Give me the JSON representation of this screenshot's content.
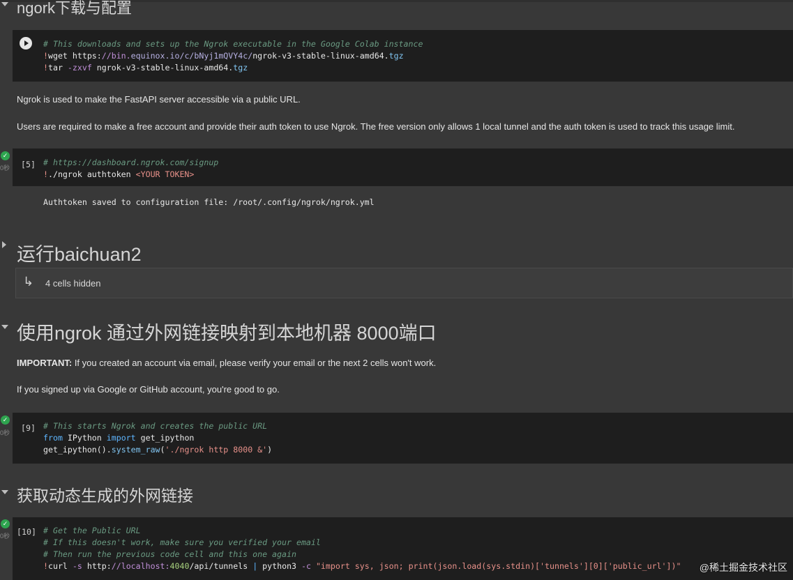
{
  "sections": {
    "s1_title": "ngork下载与配置",
    "s2_title": "运行baichuan2",
    "s3_title": "使用ngrok 通过外网链接映射到本地机器 8000端口",
    "s4_title": "获取动态生成的外网链接"
  },
  "cell1": {
    "line1_comment": "# This downloads and sets up the Ngrok executable in the Google Colab instance",
    "wget_bang": "!",
    "wget_cmd": "wget https:",
    "wget_url_a": "//bin.",
    "wget_url_b": "equinox.",
    "wget_url_c": "io/",
    "wget_url_d": "c/",
    "wget_url_e": "bNyj1mQVY4c/",
    "wget_url_f": "ngrok-v3-stable-linux-amd64.",
    "wget_url_g": "tgz",
    "tar_bang": "!",
    "tar_cmd": "tar",
    "tar_flag": " -zxvf",
    "tar_file": " ngrok-v3-stable-linux-amd64.",
    "tar_ext": "tgz"
  },
  "para1": "Ngrok is used to make the FastAPI server accessible via a public URL.",
  "para2": "Users are required to make a free account and provide their auth token to use Ngrok. The free version only allows 1 local tunnel and the auth token is used to track this usage limit.",
  "cell2": {
    "prompt": "[5]",
    "exec_time": "0秒",
    "comment": "# https://dashboard.ngrok.com/signup",
    "bang": "!",
    "cmd": "./ngrok authtoken ",
    "token": "<YOUR TOKEN>",
    "output": "Authtoken saved to configuration file: /root/.config/ngrok/ngrok.yml"
  },
  "hidden_cells": {
    "label": "4 cells hidden"
  },
  "para3_bold": "IMPORTANT:",
  "para3_rest": " If you created an account via email, please verify your email or the next 2 cells won't work.",
  "para4": "If you signed up via Google or GitHub account, you're good to go.",
  "cell3": {
    "prompt": "[9]",
    "exec_time": "0秒",
    "comment": "# This starts Ngrok and creates the public URL",
    "from_kw": "from",
    "module": " IPython ",
    "import_kw": "import",
    "imported": " get_ipython",
    "call_a": "get_ipython().",
    "call_fn": "system_raw",
    "call_b": "(",
    "call_str": "'./ngrok http 8000 &'",
    "call_c": ")"
  },
  "cell4": {
    "prompt": "[10]",
    "exec_time": "0秒",
    "c1": "# Get the Public URL",
    "c2": "# If this doesn't work, make sure you verified your email",
    "c3": "# Then run the previous code cell and this one again",
    "bang": "!",
    "curl": "curl",
    "flag_s": " -s",
    "url_a": " http:",
    "url_b": "//localhost:",
    "port": "4040",
    "url_c": "/api/tunnels ",
    "pipe": "|",
    "py": " python3",
    "flag_c": " -c",
    "py_str": " \"import sys, json; print(json.load(sys.stdin)['tunnels'][0]['public_url'])\""
  },
  "watermark": "@稀土掘金技术社区",
  "colors": {
    "background": "#383838",
    "code_background": "#1e1e1e",
    "comment": "#6a9a82",
    "keyword": "#5eb6ff",
    "string": "#e8918a",
    "success": "#2ea44f"
  },
  "icons": {
    "run": "play-circle-icon",
    "collapse": "chevron-down-icon",
    "expand": "chevron-right-icon",
    "done": "check-circle-icon",
    "hidden": "arrow-return-icon"
  }
}
